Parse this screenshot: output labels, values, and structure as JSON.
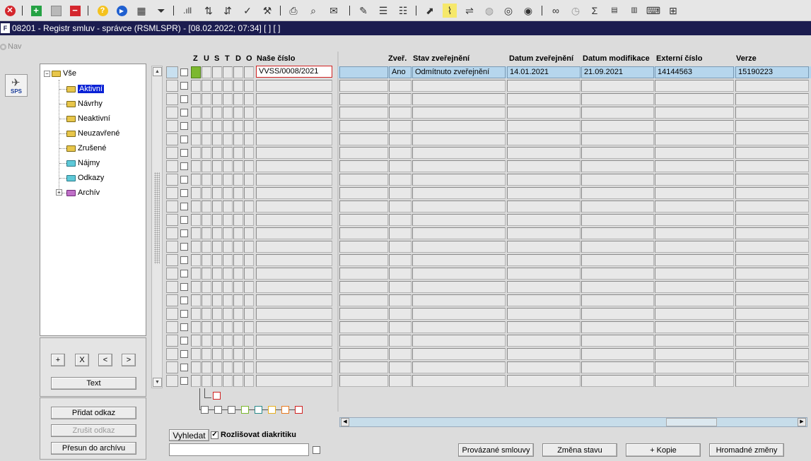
{
  "toolbar": {
    "icons": [
      "close-icon",
      "add-icon",
      "save-icon",
      "delete-icon",
      "help-icon",
      "run-icon",
      "calendar-icon",
      "filter-icon",
      "chart-icon",
      "sort-asc-icon",
      "sort-desc-icon",
      "check-icon",
      "wrench-icon",
      "print-icon",
      "print-preview-icon",
      "mail-icon",
      "edit-icon",
      "list-icon",
      "checklist-icon",
      "export-icon",
      "attach-icon",
      "align-icon",
      "globe-icon",
      "compass-icon",
      "eye-icon",
      "glasses-icon",
      "clock-icon",
      "sum-icon",
      "excel-icon",
      "xml-icon",
      "keyboard-icon",
      "tree-icon"
    ]
  },
  "titlebar": {
    "text": "08201 - Registr smluv - správce (RSMLSPR) - [08.02.2022; 07:34]  [ ]  [ ]",
    "logo": "F"
  },
  "nav": {
    "label": "Nav"
  },
  "sidebar": {
    "sps_label": "SPS"
  },
  "tree": {
    "root": "Vše",
    "items": [
      {
        "label": "Aktivní",
        "selected": true,
        "color": "#e8c64a"
      },
      {
        "label": "Návrhy",
        "color": "#e8c64a"
      },
      {
        "label": "Neaktivní",
        "color": "#e8c64a"
      },
      {
        "label": "Neuzavřené",
        "color": "#e8c64a"
      },
      {
        "label": "Zrušené",
        "color": "#e8c64a"
      },
      {
        "label": "Nájmy",
        "color": "#5ec9d8"
      },
      {
        "label": "Odkazy",
        "color": "#5ec9d8"
      },
      {
        "label": "Archív",
        "color": "#c070c8"
      }
    ]
  },
  "tree_controls": {
    "plus": "+",
    "x": "X",
    "prev": "<",
    "next": ">",
    "text": "Text"
  },
  "tree_actions": {
    "add_link": "Přidat odkaz",
    "remove_link": "Zrušit odkaz",
    "archive": "Přesun do archívu"
  },
  "grid": {
    "flag_headers": [
      "Z",
      "U",
      "S",
      "T",
      "D",
      "O"
    ],
    "columns": [
      "Naše číslo",
      "Zveř.",
      "Stav zveřejnění",
      "Datum zveřejnění",
      "Datum modifikace",
      "Externí číslo",
      "Verze"
    ],
    "rows": [
      {
        "cislo": "VVSS/0008/2021",
        "zver": "Ano",
        "stav": "Odmítnuto zveřejnění",
        "datum_zver": "14.01.2021",
        "datum_mod": "21.09.2021",
        "externi": "14144563",
        "verze": "15190223"
      }
    ],
    "row_count": 24
  },
  "search": {
    "button": "Vyhledat",
    "diacritics_label": "Rozlišovat diakritiku",
    "diacritics_checked": true,
    "value": ""
  },
  "bottom_buttons": {
    "linked": "Provázané smlouvy",
    "change_state": "Změna stavu",
    "copy": "+ Kopie",
    "bulk": "Hromadné změny"
  },
  "colors": {
    "titlebar": "#1b1c4f",
    "selected_row": "#b6d6ed",
    "tree_selected": "#0a22d6",
    "red_border": "#d02020",
    "green_flag": "#7cb82f"
  }
}
